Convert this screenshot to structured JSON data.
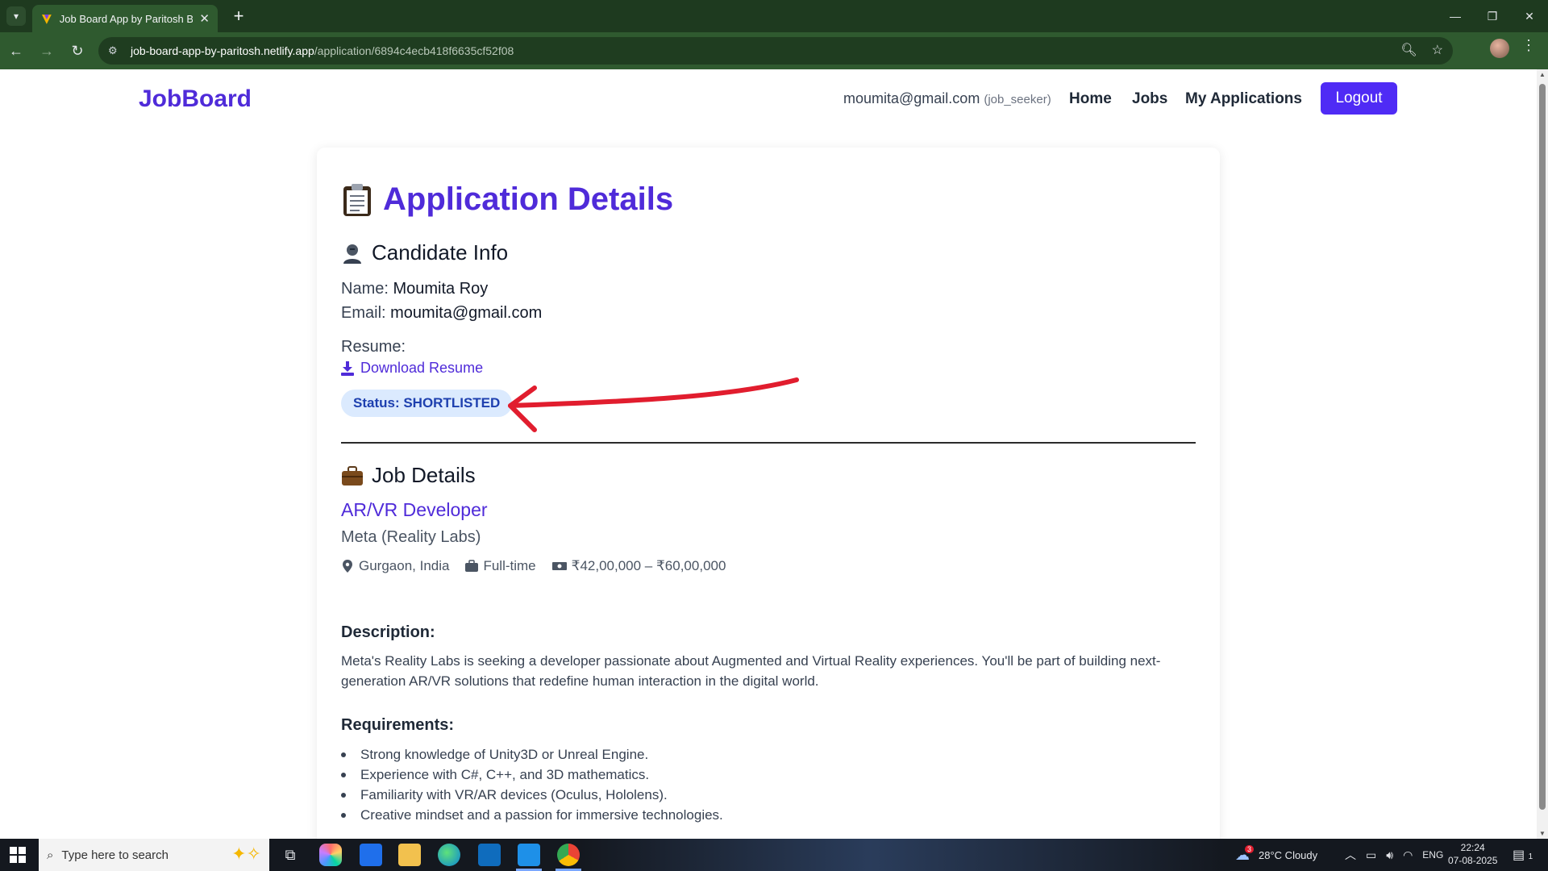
{
  "browser": {
    "tab_title": "Job Board App by Paritosh Barm",
    "url_host": "job-board-app-by-paritosh.netlify.app",
    "url_path": "/application/6894c4ecb418f6635cf52f08"
  },
  "navbar": {
    "brand": "JobBoard",
    "user_email": "moumita@gmail.com",
    "user_role": "(job_seeker)",
    "links": [
      "Home",
      "Jobs",
      "My Applications"
    ],
    "logout": "Logout"
  },
  "application": {
    "title": "Application Details",
    "candidate_heading": "Candidate Info",
    "name_label": "Name:",
    "name_value": "Moumita Roy",
    "email_label": "Email:",
    "email_value": "moumita@gmail.com",
    "resume_label": "Resume:",
    "download_label": "Download Resume",
    "status_text": "Status: SHORTLISTED",
    "status_color": "#1e40af"
  },
  "job": {
    "heading": "Job Details",
    "title": "AR/VR Developer",
    "company": "Meta (Reality Labs)",
    "location": "Gurgaon, India",
    "type": "Full-time",
    "salary": "₹42,00,000 – ₹60,00,000",
    "description_label": "Description:",
    "description": "Meta's Reality Labs is seeking a developer passionate about Augmented and Virtual Reality experiences. You'll be part of building next-generation AR/VR solutions that redefine human interaction in the digital world.",
    "requirements_label": "Requirements:",
    "requirements": [
      "Strong knowledge of Unity3D or Unreal Engine.",
      "Experience with C#, C++, and 3D mathematics.",
      "Familiarity with VR/AR devices (Oculus, Hololens).",
      "Creative mindset and a passion for immersive technologies."
    ]
  },
  "taskbar": {
    "search_placeholder": "Type here to search",
    "weather": "28°C Cloudy",
    "weather_badge": "3",
    "language": "ENG",
    "time": "22:24",
    "date": "07-08-2025",
    "notification_count": "1"
  },
  "colors": {
    "accent": "#4f2bd9",
    "button": "#4f2bf5",
    "status_bg": "#dbeafe",
    "chrome": "#2f5a2f"
  }
}
